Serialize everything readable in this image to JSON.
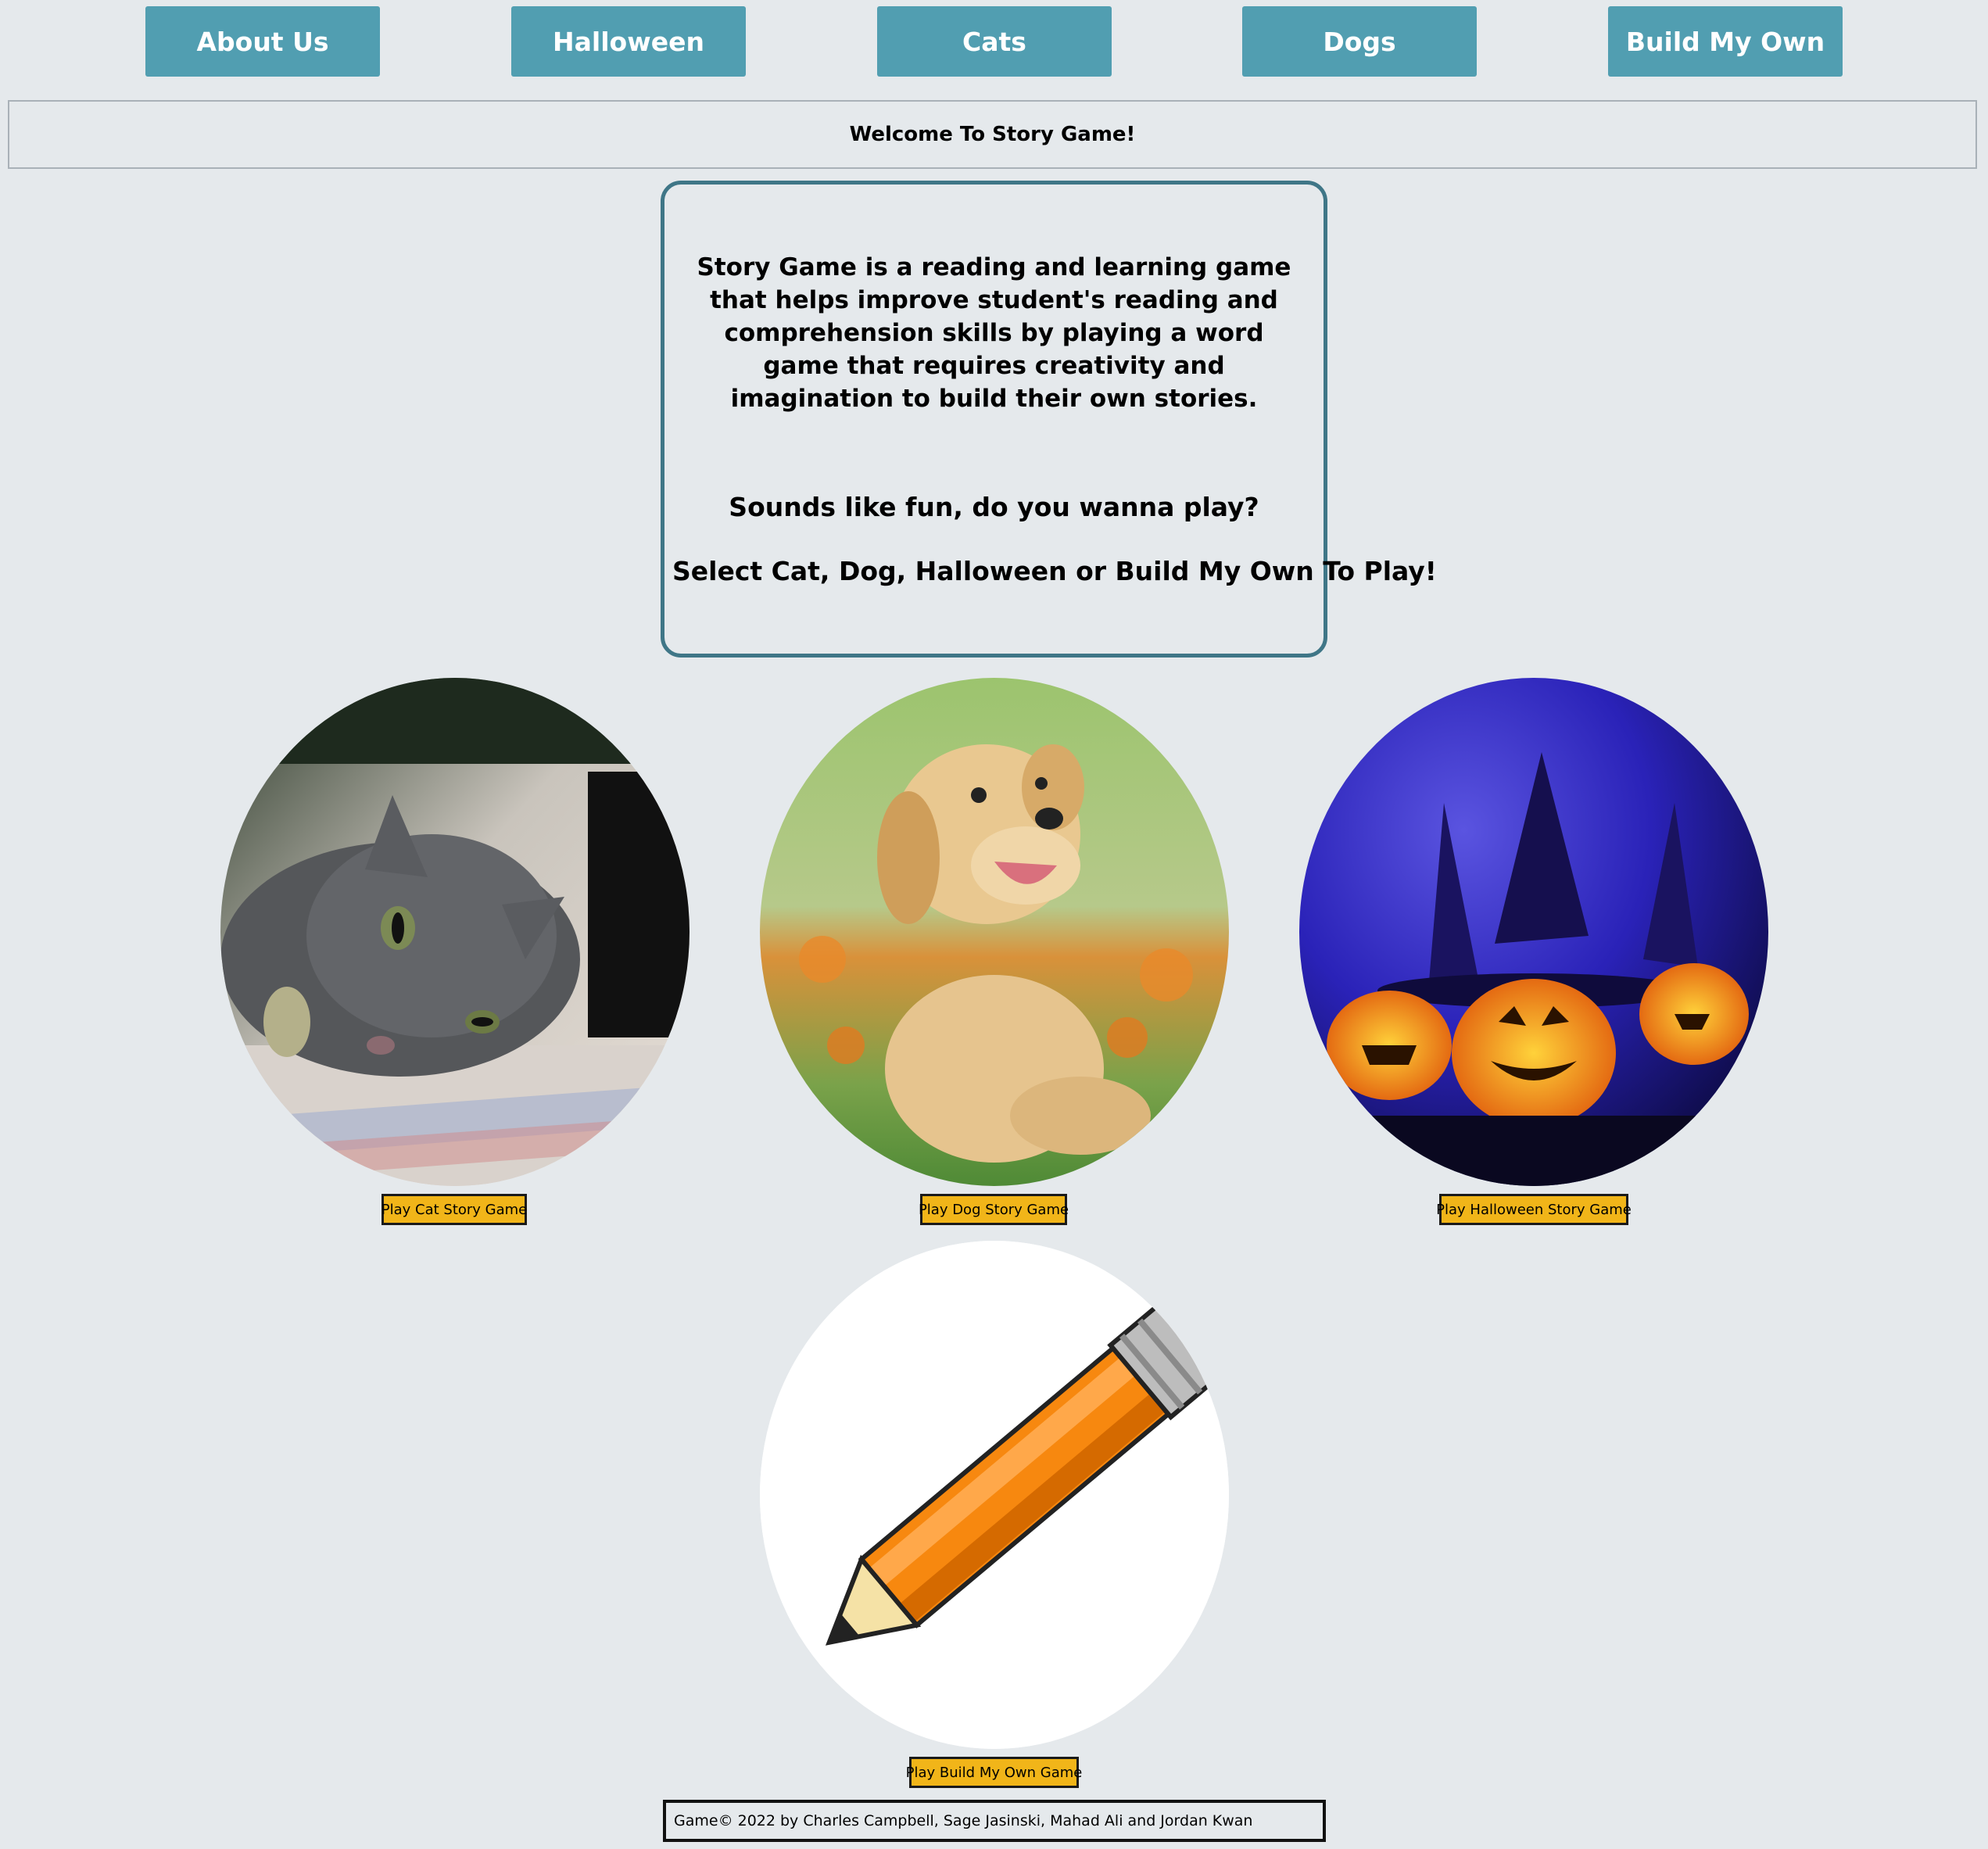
{
  "nav": {
    "about": "About Us",
    "halloween": "Halloween",
    "cats": "Cats",
    "dogs": "Dogs",
    "build": "Build My Own"
  },
  "welcome": "Welcome To Story Game!",
  "info": {
    "intro": "Story Game is a reading and learning game that helps improve student's reading and comprehension skills by playing a word game that requires creativity and imagination to build their own stories.",
    "prompt": "Sounds like fun, do you wanna play?",
    "select": "Select Cat, Dog, Halloween or Build My Own To Play!"
  },
  "games": {
    "cat": "Play Cat Story Game",
    "dog": "Play Dog Story Game",
    "halloween": "Play Halloween Story Game",
    "build": "Play Build My Own Game"
  },
  "footer": "Game© 2022 by Charles Campbell, Sage Jasinski, Mahad Ali and Jordan Kwan",
  "colors": {
    "background": "#e5e9ec",
    "nav_button": "#519eb1",
    "play_button": "#f1b519",
    "info_border": "#3f7687"
  },
  "images": {
    "cat": "gray-cat-photo",
    "dog": "golden-puppy-photo",
    "halloween": "jack-o-lantern-photo",
    "build": "pencil-illustration"
  }
}
